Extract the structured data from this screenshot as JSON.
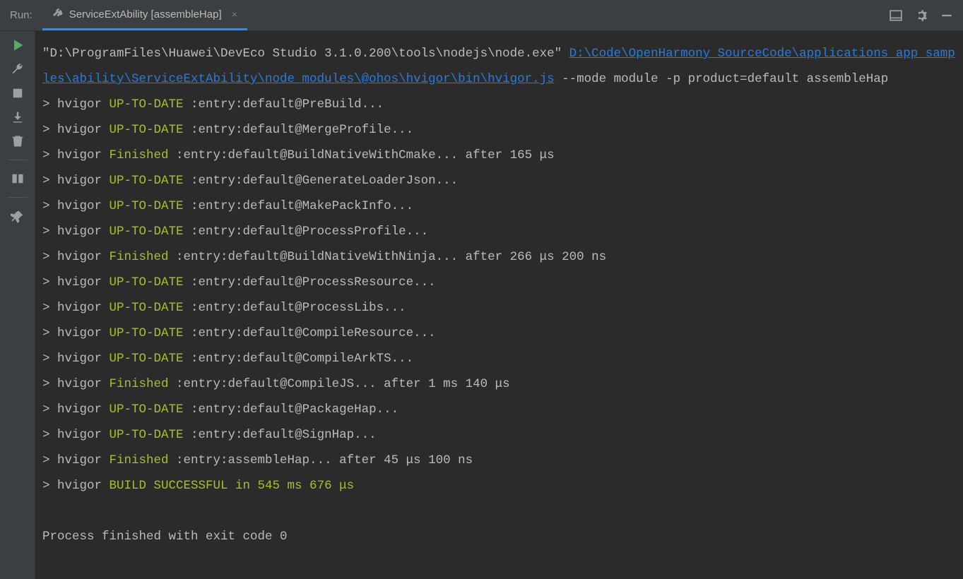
{
  "header": {
    "run_label": "Run:",
    "tab_label": "ServiceExtAbility [assembleHap]"
  },
  "console": {
    "cmd_prefix": "\"D:\\ProgramFiles\\Huawei\\DevEco Studio 3.1.0.200\\tools\\nodejs\\node.exe\" ",
    "cmd_link": "D:\\Code\\OpenHarmony_SourceCode\\applications_app_samples\\ability\\ServiceExtAbility\\node_modules\\@ohos\\hvigor\\bin\\hvigor.js",
    "cmd_suffix": " --mode module -p product=default assembleHap",
    "lines": [
      {
        "status": "UP-TO-DATE",
        "task": ":entry:default@PreBuild...",
        "timing": ""
      },
      {
        "status": "UP-TO-DATE",
        "task": ":entry:default@MergeProfile...",
        "timing": ""
      },
      {
        "status": "Finished",
        "task": ":entry:default@BuildNativeWithCmake...",
        "timing": " after 165 μs"
      },
      {
        "status": "UP-TO-DATE",
        "task": ":entry:default@GenerateLoaderJson...",
        "timing": ""
      },
      {
        "status": "UP-TO-DATE",
        "task": ":entry:default@MakePackInfo...",
        "timing": ""
      },
      {
        "status": "UP-TO-DATE",
        "task": ":entry:default@ProcessProfile...",
        "timing": ""
      },
      {
        "status": "Finished",
        "task": ":entry:default@BuildNativeWithNinja...",
        "timing": " after 266 μs 200 ns"
      },
      {
        "status": "UP-TO-DATE",
        "task": ":entry:default@ProcessResource...",
        "timing": ""
      },
      {
        "status": "UP-TO-DATE",
        "task": ":entry:default@ProcessLibs...",
        "timing": ""
      },
      {
        "status": "UP-TO-DATE",
        "task": ":entry:default@CompileResource...",
        "timing": ""
      },
      {
        "status": "UP-TO-DATE",
        "task": ":entry:default@CompileArkTS...",
        "timing": ""
      },
      {
        "status": "Finished",
        "task": ":entry:default@CompileJS...",
        "timing": " after 1 ms 140 μs"
      },
      {
        "status": "UP-TO-DATE",
        "task": ":entry:default@PackageHap...",
        "timing": ""
      },
      {
        "status": "UP-TO-DATE",
        "task": ":entry:default@SignHap...",
        "timing": ""
      },
      {
        "status": "Finished",
        "task": ":entry:assembleHap...",
        "timing": " after 45 μs 100 ns"
      }
    ],
    "build_result": "BUILD SUCCESSFUL in 545 ms 676 μs",
    "exit_msg": "Process finished with exit code 0",
    "line_prefix": "> hvigor "
  }
}
